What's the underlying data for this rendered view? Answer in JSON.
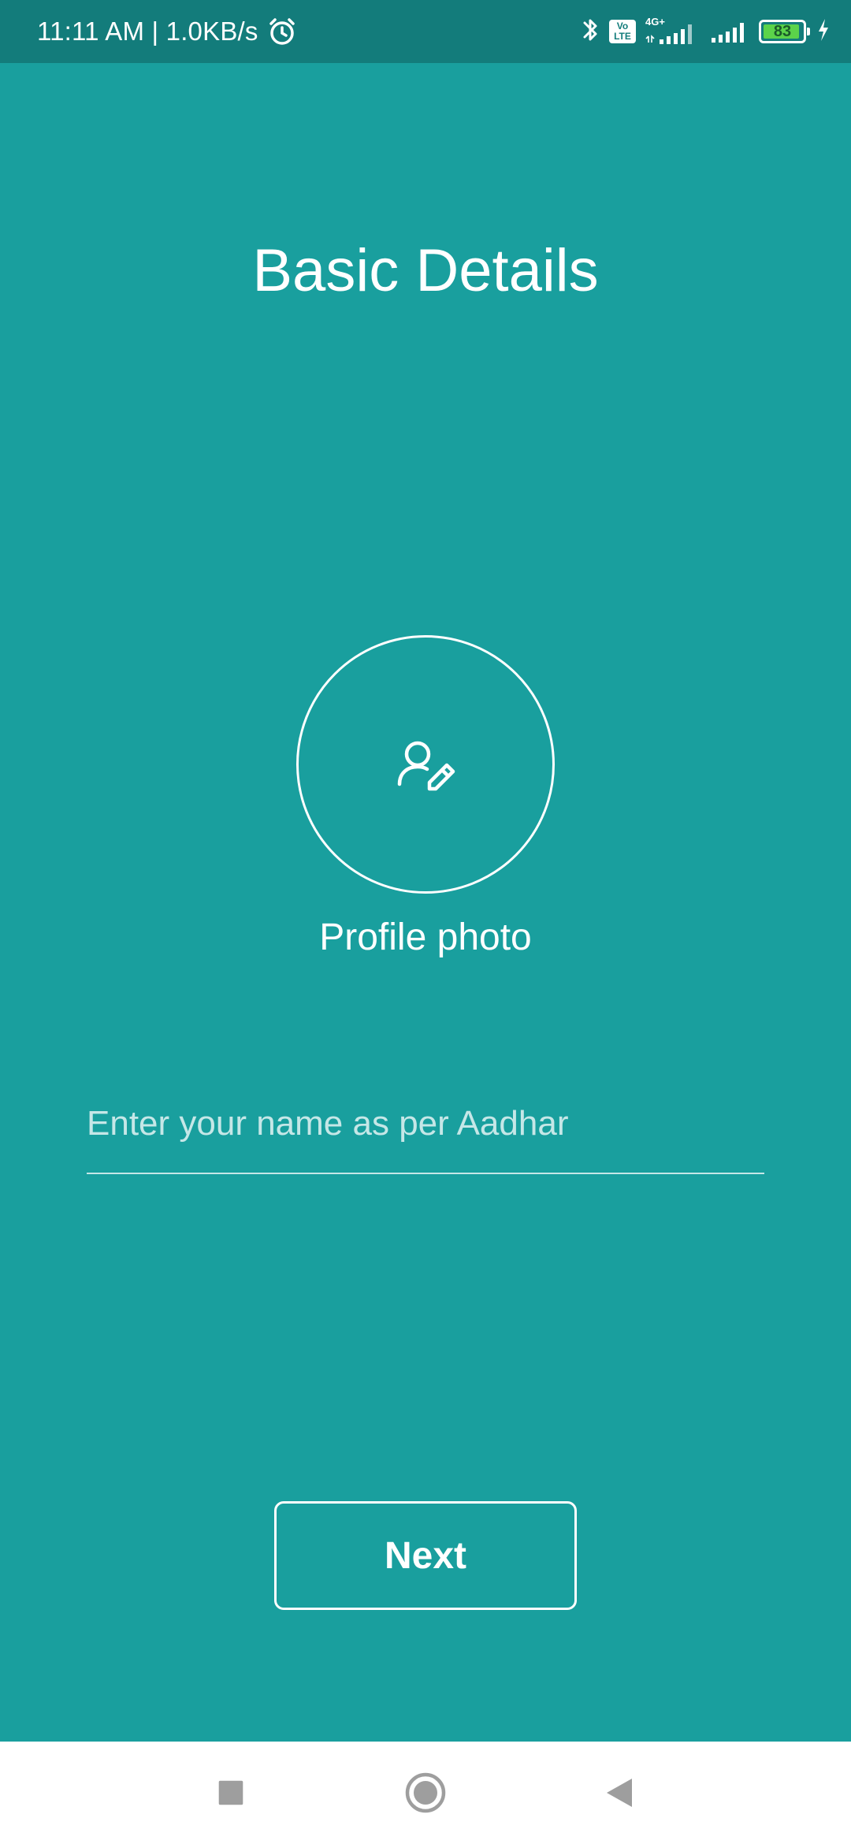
{
  "status_bar": {
    "time_speed": "11:11 AM | 1.0KB/s",
    "network_type": "4G+",
    "volte_label": "Vo\nLTE",
    "battery_level": "83"
  },
  "main": {
    "title": "Basic Details",
    "profile_photo_label": "Profile photo",
    "name_input": {
      "placeholder": "Enter your name as per Aadhar",
      "value": ""
    },
    "next_label": "Next"
  },
  "colors": {
    "background": "#199f9e",
    "status_bar": "#137c7b",
    "battery_fill": "#5bd34a",
    "nav_bar": "#ffffff",
    "nav_icons": "#9e9e9e"
  },
  "icons": {
    "alarm": "alarm-icon",
    "bluetooth": "bluetooth-icon",
    "signal": "signal-icon",
    "battery": "battery-icon",
    "charging": "charging-icon",
    "avatar_edit": "person-edit-icon",
    "nav_recent": "square-icon",
    "nav_home": "circle-icon",
    "nav_back": "triangle-back-icon"
  }
}
